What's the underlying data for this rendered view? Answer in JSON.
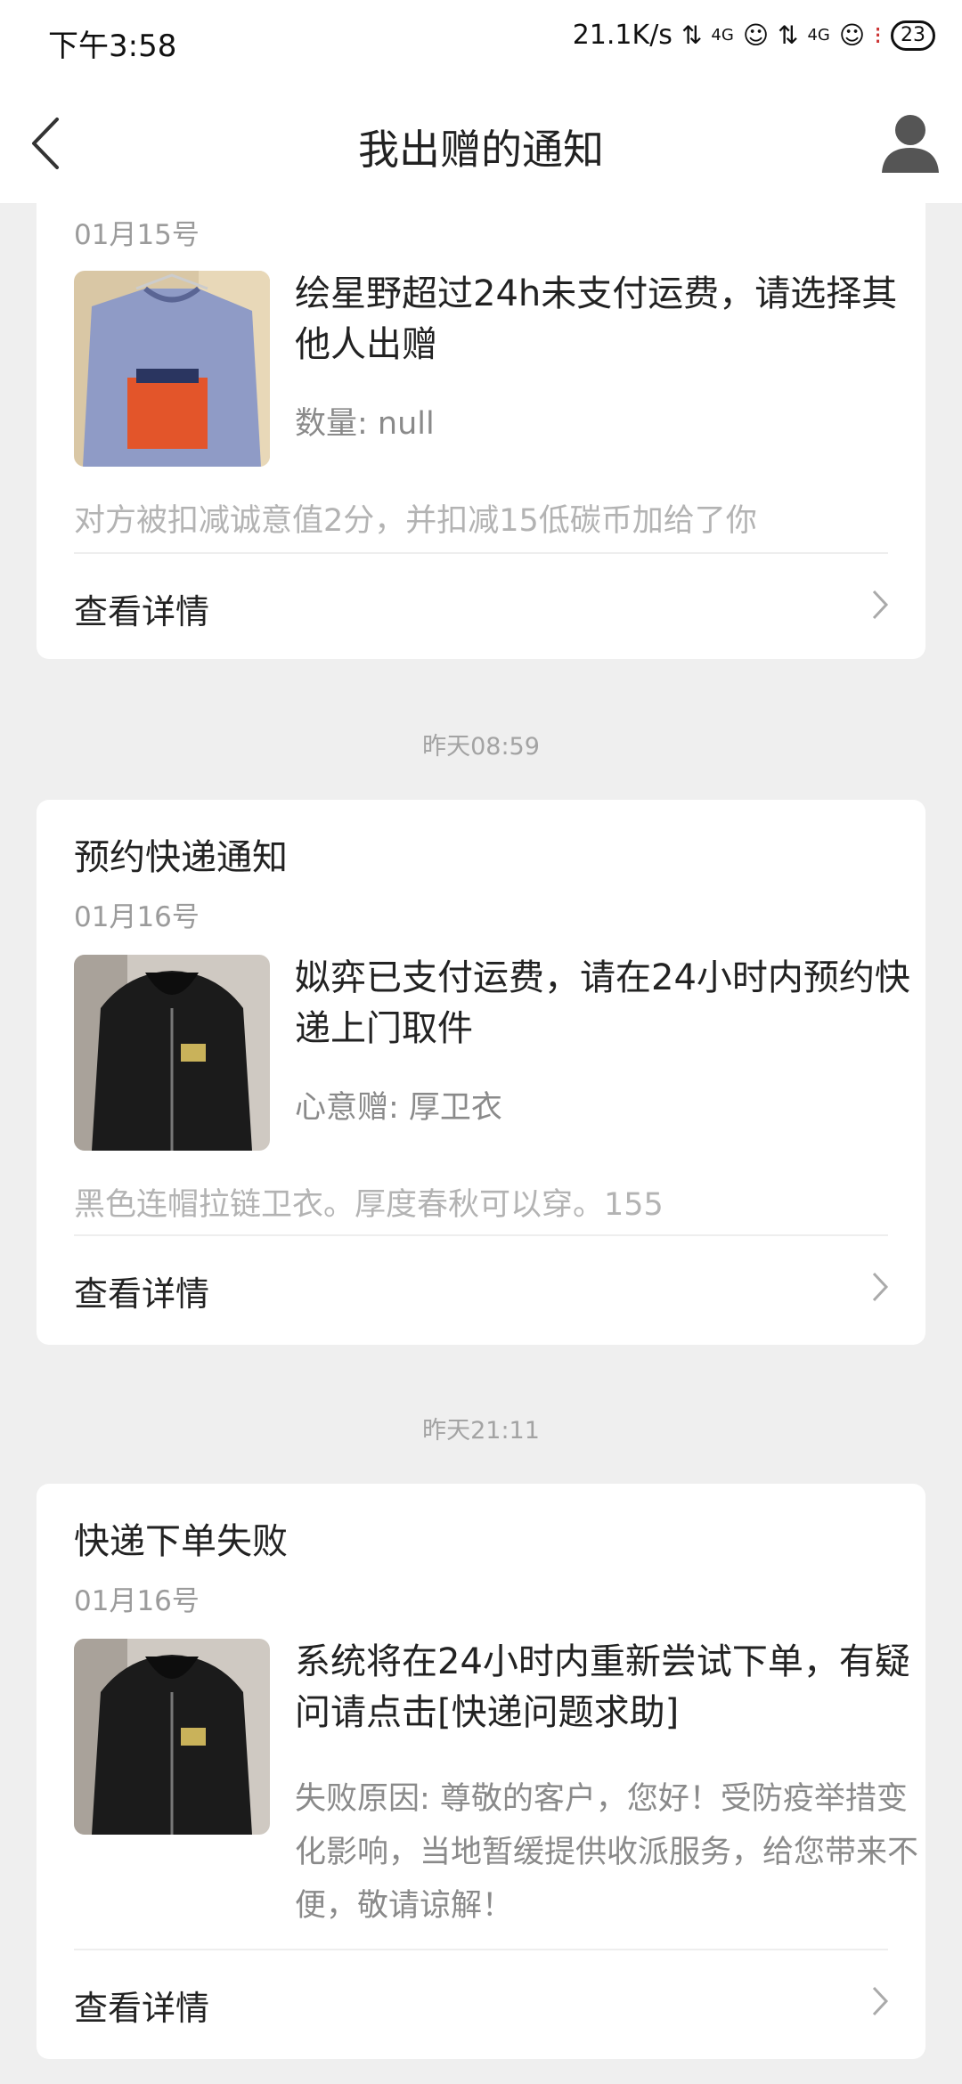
{
  "status_bar": {
    "time": "下午3:58",
    "net_speed": "21.1K/s",
    "signal_label_1": "4G",
    "signal_label_2": "4G",
    "battery": "23"
  },
  "header": {
    "title": "我出赠的通知",
    "back_icon": "chevron-left-icon",
    "profile_icon": "user-icon"
  },
  "cards": [
    {
      "date": "01月15号",
      "message": "绘星野超过24h未支付运费，请选择其他人出赠",
      "sub": "数量: null",
      "note": "对方被扣减诚意值2分，并扣减15低碳币加给了你",
      "detail_label": "查看详情"
    },
    {
      "title": "预约快递通知",
      "date": "01月16号",
      "message": "姒弈已支付运费，请在24小时内预约快递上门取件",
      "sub": "心意赠: 厚卫衣",
      "note": "黑色连帽拉链卫衣。厚度春秋可以穿。155",
      "detail_label": "查看详情"
    },
    {
      "title": "快递下单失败",
      "date": "01月16号",
      "message": "系统将在24小时内重新尝试下单，有疑问请点击[快递问题求助]",
      "sub": "失败原因: 尊敬的客户，您好！受防疫举措变化影响，当地暂缓提供收派服务，给您带来不便，敬请谅解！",
      "detail_label": "查看详情"
    }
  ],
  "separators": [
    "昨天08:59",
    "昨天21:11"
  ],
  "colors": {
    "background": "#efefef",
    "card": "#ffffff",
    "muted_text": "#9b9b9b"
  }
}
